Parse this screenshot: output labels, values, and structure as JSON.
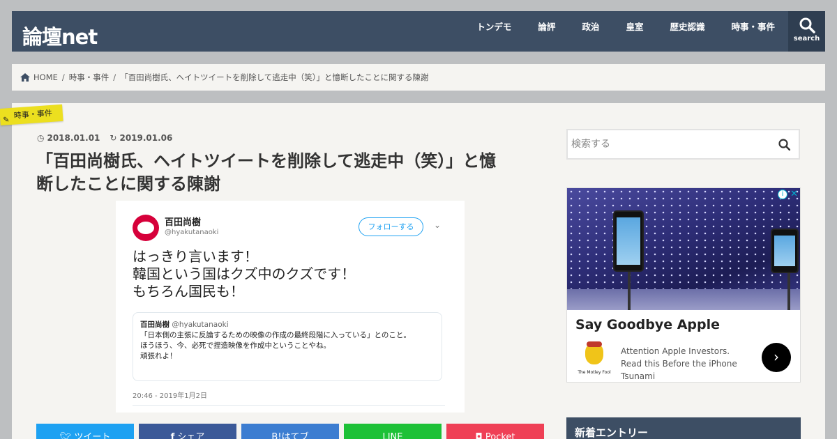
{
  "header": {
    "logo": "論壇net",
    "nav": [
      "トンデモ",
      "論評",
      "政治",
      "皇室",
      "歴史認識",
      "時事・事件"
    ],
    "search_label": "search"
  },
  "breadcrumb": {
    "home": "HOME",
    "category": "時事・事件",
    "current": "「百田尚樹氏、ヘイトツイートを削除して逃走中（笑）」と憶断したことに関する陳謝"
  },
  "article": {
    "category_tag": "時事・事件",
    "published": "2018.01.01",
    "updated": "2019.01.06",
    "title_line1": "「百田尚樹氏、ヘイトツイートを削除して逃走中（笑）」と憶",
    "title_line2": "断したことに関する陳謝"
  },
  "tweet": {
    "name": "百田尚樹",
    "handle": "@hyakutanaoki",
    "follow": "フォローする",
    "body": [
      "はっきり言います！",
      "韓国という国はクズ中のクズです！",
      "もちろん国民も！"
    ],
    "quote_name": "百田尚樹",
    "quote_handle": "@hyakutanaoki",
    "quote_lines": [
      "「日本側の主張に反論するための映像の作成の最終段階に入っている」とのこと。",
      "ほうほう、今、必死で捏造映像を作成中ということやね。",
      "頑張れよ！"
    ],
    "time": "20:46 - 2019年1月2日"
  },
  "share": [
    {
      "label": "ツイート",
      "icon": "twitter-icon",
      "color": "#1da1f2"
    },
    {
      "label": "シェア",
      "icon": "facebook-icon",
      "color": "#3b5998"
    },
    {
      "label": "B!はてブ",
      "icon": "hatena-icon",
      "color": "#3c7dd1"
    },
    {
      "label": "LINE",
      "icon": "line-icon",
      "color": "#1dc137"
    },
    {
      "label": "Pocket",
      "icon": "pocket-icon",
      "color": "#ef4056"
    }
  ],
  "sidebar": {
    "search_placeholder": "検索する",
    "ad": {
      "title": "Say Goodbye Apple",
      "desc": "Attention Apple Investors. Read this Before the iPhone Tsunami",
      "logo_text": "The Motley Fool"
    },
    "new_entries": "新着エントリー"
  }
}
